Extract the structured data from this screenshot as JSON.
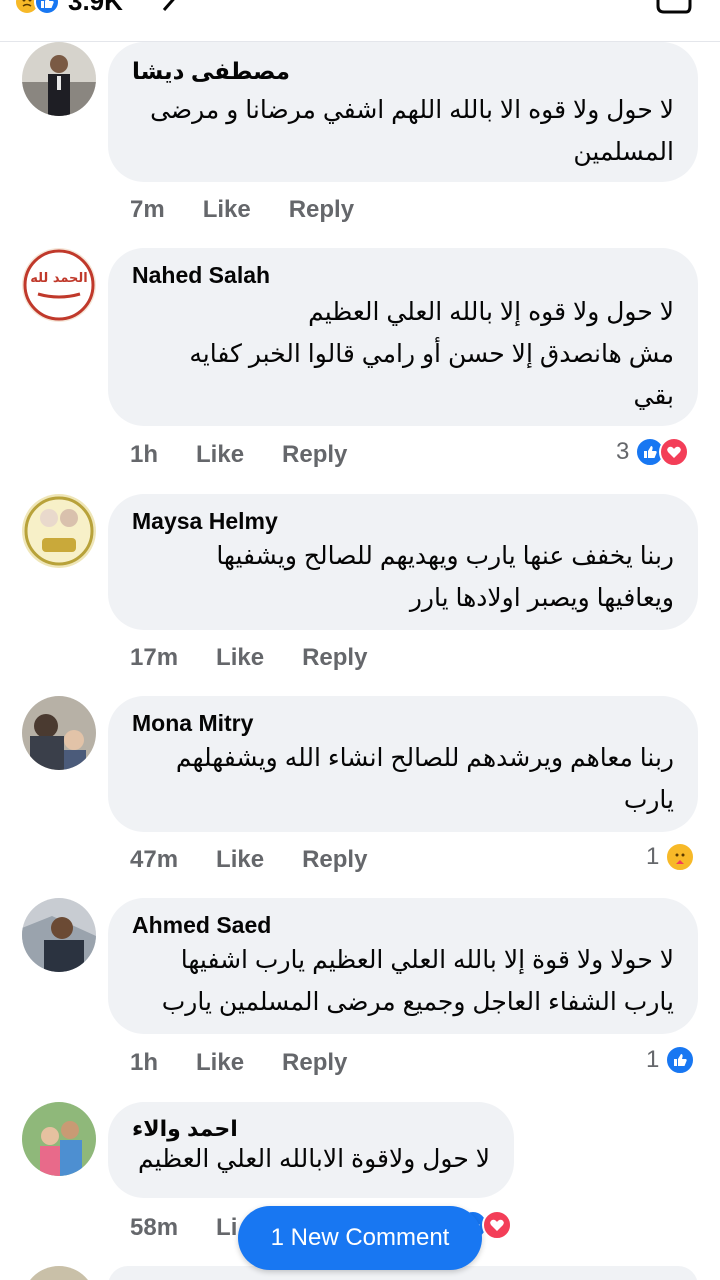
{
  "header": {
    "reaction_count": "3.9K"
  },
  "comments": [
    {
      "author": "مصطفى ديشا",
      "text": "لا حول ولا قوه الا بالله اللهم اشفي مرضانا و مرضى\nالمسلمين",
      "time": "7m",
      "like_label": "Like",
      "reply_label": "Reply"
    },
    {
      "author": "Nahed Salah",
      "text": "لا حول ولا قوه إلا بالله العلي العظيم\nمش هانصدق إلا حسن أو رامي قالوا الخبر   كفايه\nبقي",
      "time": "1h",
      "like_label": "Like",
      "reply_label": "Reply",
      "reaction_count": "3",
      "avatar_text": "الحمد لله"
    },
    {
      "author": "Maysa Helmy",
      "text": "ربنا يخفف عنها يارب ويهديهم للصالح ويشفيها\nويعافيها ويصبر اولادها يارر",
      "time": "17m",
      "like_label": "Like",
      "reply_label": "Reply"
    },
    {
      "author": "Mona Mitry",
      "text": "ربنا معاهم   ويرشدهم للصالح انشاء الله ويشفهلهم\nيارب",
      "time": "47m",
      "like_label": "Like",
      "reply_label": "Reply",
      "reaction_count": "1"
    },
    {
      "author": "Ahmed Saed",
      "text": "لا حولا ولا قوة إلا بالله العلي العظيم  يارب اشفيها\nيارب الشفاء العاجل وجميع مرضى المسلمين  يارب",
      "time": "1h",
      "like_label": "Like",
      "reply_label": "Reply",
      "reaction_count": "1"
    },
    {
      "author": "احمد والاء",
      "text": "لا حول ولاقوة الابالله العلي العظيم",
      "time": "58m",
      "like_label": "Li"
    }
  ],
  "new_comment_button": "1 New Comment",
  "colors": {
    "accent": "#1877f2",
    "bubble": "#f0f2f5",
    "meta": "#65676b",
    "love": "#f33e58"
  },
  "icons": [
    "sad-reaction-icon",
    "like-reaction-icon",
    "love-reaction-icon",
    "care-reaction-icon",
    "chevron-icon",
    "share-icon"
  ]
}
